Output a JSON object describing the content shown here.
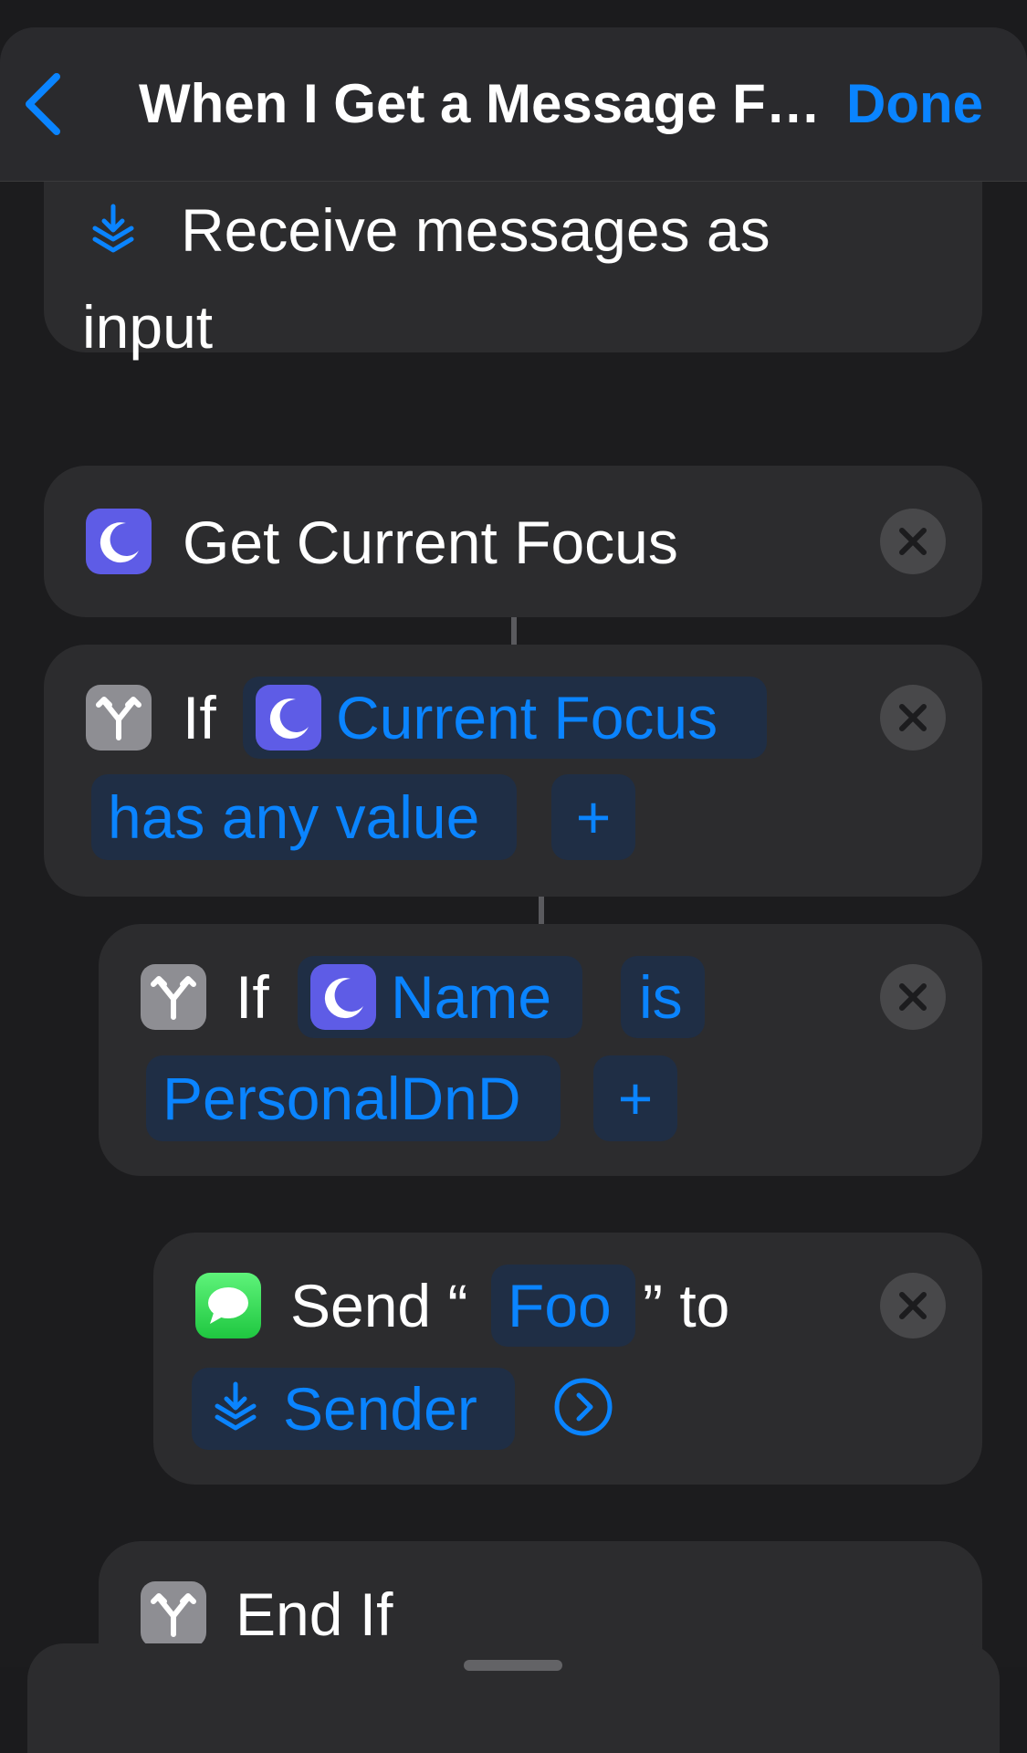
{
  "navbar": {
    "title": "When I Get a Message F…",
    "done_label": "Done"
  },
  "receive_action": {
    "line1": "Receive messages as",
    "line2": "input"
  },
  "get_focus_action": {
    "label": "Get Current Focus"
  },
  "if_outer": {
    "keyword": "If",
    "variable": "Current Focus",
    "condition": "has any value",
    "add_label": "+"
  },
  "if_inner": {
    "keyword": "If",
    "variable": "Name",
    "operator": "is",
    "value": "PersonalDnD",
    "add_label": "+"
  },
  "send_action": {
    "send_word": "Send “",
    "message": "Foo",
    "to_word": "” to",
    "recipient": "Sender"
  },
  "end_if_action": {
    "label": "End If"
  },
  "colors": {
    "accent": "#0a84ff",
    "focus_tile": "#5e5ce6",
    "branch_tile": "#8e8e93",
    "card": "#2c2c2e"
  },
  "icons": [
    "chevron-left-icon",
    "receive-input-icon",
    "moon-icon",
    "branch-icon",
    "messages-icon",
    "close-icon",
    "chevron-right-circle-icon"
  ]
}
